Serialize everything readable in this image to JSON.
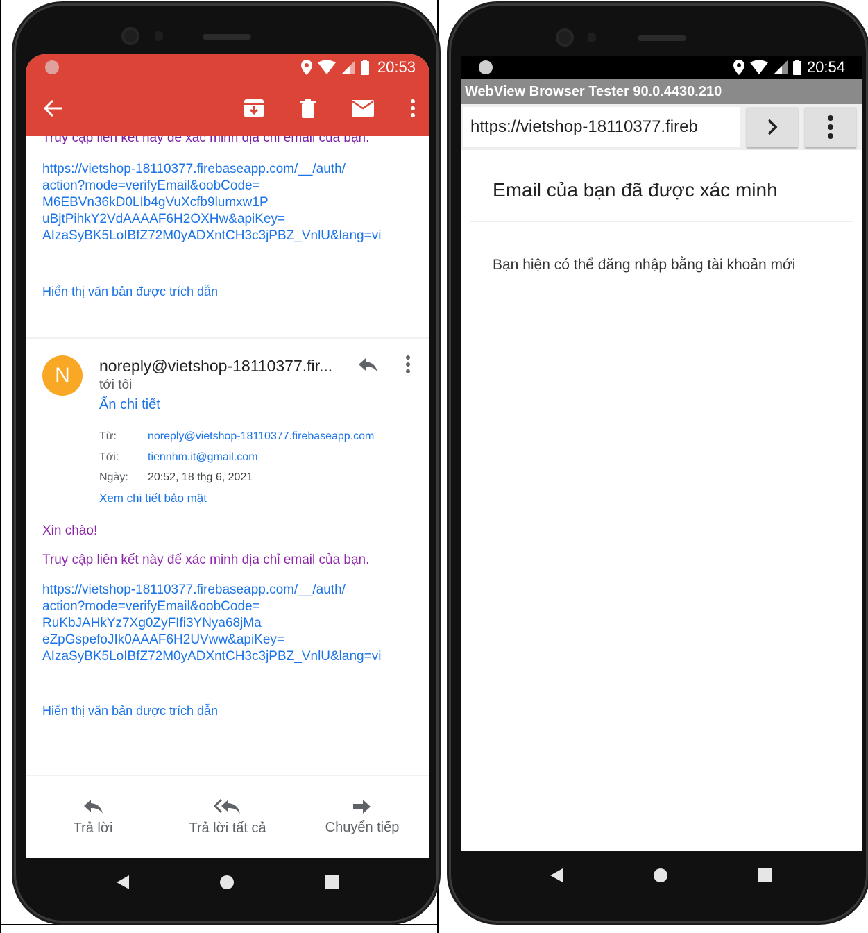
{
  "gmail": {
    "status_time": "20:53",
    "clipped_text": "Truy cập liên kết này để xác minh địa chỉ email của bạn.",
    "link1": [
      "https://vietshop-18110377.firebaseapp.com/__/auth/",
      "action?mode=verifyEmail&oobCode=",
      "M6EBVn36kD0LIb4gVuXcfb9lumxw1P",
      "uBjtPihkY2VdAAAAF6H2OXHw&apiKey=",
      "AIzaSyBK5LoIBfZ72M0yADXntCH3c3jPBZ_VnlU&lang=vi"
    ],
    "show_quoted_1": "Hiển thị văn bản được trích dẫn",
    "avatar_letter": "N",
    "sender": "noreply@vietshop-18110377.fir...",
    "to_me": "tới tôi",
    "hide_details": "Ẩn chi tiết",
    "details": {
      "from_label": "Từ:",
      "from_value": "noreply@vietshop-18110377.firebaseapp.com",
      "to_label": "Tới:",
      "to_value": "tiennhm.it@gmail.com",
      "date_label": "Ngày:",
      "date_value": "20:52, 18 thg 6, 2021",
      "security_link": "Xem chi tiết bảo mật"
    },
    "greeting": "Xin chào!",
    "body_text": "Truy cập liên kết này để xác minh địa chỉ email của bạn.",
    "link2": [
      "https://vietshop-18110377.firebaseapp.com/__/auth/",
      "action?mode=verifyEmail&oobCode=",
      "RuKbJAHkYz7Xg0ZyFIfi3YNya68jMa",
      "eZpGspefoJIk0AAAF6H2UVww&apiKey=",
      "AIzaSyBK5LoIBfZ72M0yADXntCH3c3jPBZ_VnlU&lang=vi"
    ],
    "show_quoted_2": "Hiển thị văn bản được trích dẫn",
    "actions": {
      "reply": "Trả lời",
      "reply_all": "Trả lời tất cả",
      "forward": "Chuyển tiếp"
    }
  },
  "webview": {
    "status_time": "20:54",
    "app_title": "WebView Browser Tester 90.0.4430.210",
    "url": "https://vietshop-18110377.fireb",
    "heading": "Email của bạn đã được xác minh",
    "body": "Bạn hiện có thể đăng nhập bằng tài khoản mới"
  },
  "colors": {
    "gmail_red": "#db4437",
    "link_blue": "#1a73e8",
    "purple_text": "#8e24aa",
    "avatar_orange": "#f9a825"
  },
  "icons": {
    "gmail_toolbar": [
      "back-arrow-icon",
      "archive-icon",
      "delete-icon",
      "mark-unread-icon",
      "more-vert-icon"
    ],
    "nav": [
      "nav-back-icon",
      "nav-home-icon",
      "nav-recents-icon"
    ]
  }
}
